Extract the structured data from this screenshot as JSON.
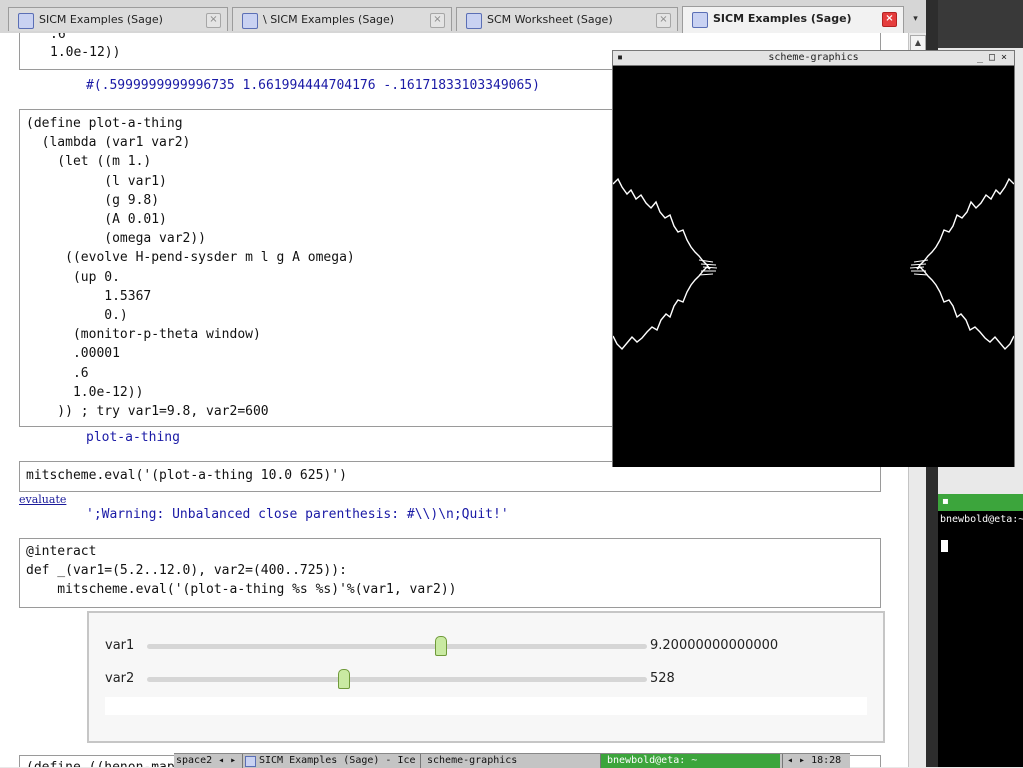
{
  "browser": {
    "tabs": [
      {
        "label": "SICM Examples (Sage)",
        "active": false
      },
      {
        "label": "\\ SICM Examples (Sage)",
        "active": false
      },
      {
        "label": "SCM Worksheet (Sage)",
        "active": false
      },
      {
        "label": "SICM Examples (Sage)",
        "active": true
      }
    ],
    "close_glyph": "×",
    "tab_menu_glyph": "▾"
  },
  "worksheet": {
    "cell0_code_lines": [
      ".6",
      "1.0e-12))"
    ],
    "cell0_output": "#(.5999999999996735 1.661994444704176 -.16171833103349065)",
    "cell1_code_lines": [
      "(define plot-a-thing",
      "  (lambda (var1 var2)",
      "    (let ((m 1.)",
      "          (l var1)",
      "          (g 9.8)",
      "          (A 0.01)",
      "          (omega var2))",
      "     ((evolve H-pend-sysder m l g A omega)",
      "      (up 0.",
      "          1.5367",
      "          0.)",
      "      (monitor-p-theta window)",
      "      .00001",
      "      .6",
      "      1.0e-12))",
      "    )) ; try var1=9.8, var2=600"
    ],
    "cell1_output": "plot-a-thing",
    "cell2_code": "mitscheme.eval('(plot-a-thing 10.0 625)')",
    "evaluate_link": "evaluate",
    "cell2_output": "';Warning: Unbalanced close parenthesis: #\\\\)\\n;Quit!'",
    "cell3_code_lines": [
      "@interact",
      "def _(var1=(5.2..12.0), var2=(400..725)):",
      "    mitscheme.eval('(plot-a-thing %s %s)'%(var1, var2))"
    ],
    "cell4_code_partial": "(define ((henon-map"
  },
  "interact": {
    "sliders": [
      {
        "label": "var1",
        "value": "9.20000000000000",
        "min": 5.2,
        "max": 12.0,
        "current": 9.2
      },
      {
        "label": "var2",
        "value": "528",
        "min": 400,
        "max": 725,
        "current": 528
      }
    ]
  },
  "graphics_window": {
    "title": "scheme-graphics",
    "buttons": {
      "menu": "▪",
      "minimize": "_",
      "maximize": "□",
      "close": "×"
    }
  },
  "terminal": {
    "title_glyph": "▪",
    "prompt": "bnewbold@eta:~"
  },
  "taskbar": {
    "items": [
      {
        "label": "space2 ◂ ▸"
      },
      {
        "label": "SICM Examples (Sage) - Ice"
      },
      {
        "label": "scheme-graphics"
      },
      {
        "label": "bnewbold@eta: ~"
      },
      {
        "label": "◂ ▸  18:28"
      }
    ]
  },
  "colors": {
    "output_text": "#1a1aa6",
    "slider_handle": "#c9eaa2",
    "terminal_active": "#3ca53c",
    "plot_background": "#000000",
    "plot_line": "#ffffff"
  }
}
